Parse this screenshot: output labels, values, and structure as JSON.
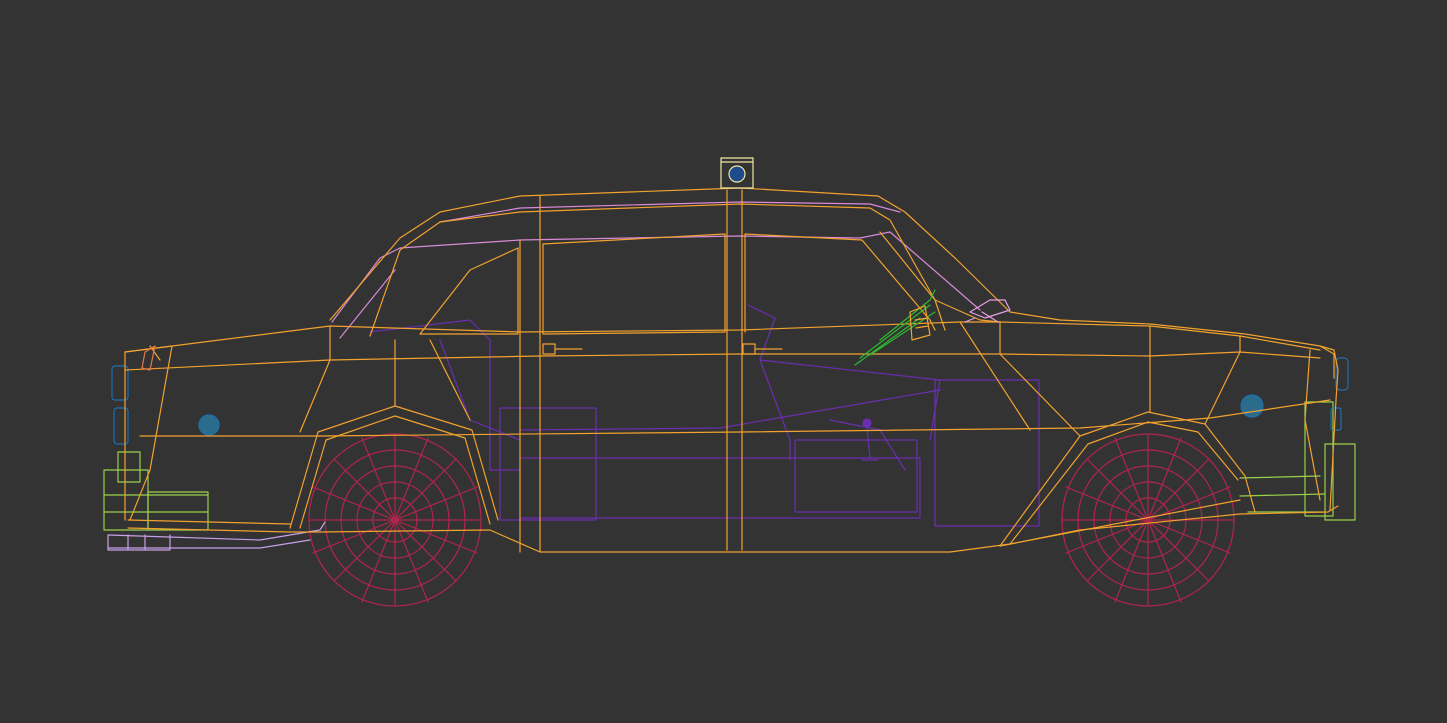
{
  "viewport": {
    "label": "",
    "background": "#333333"
  },
  "colors": {
    "body": "#f2a22e",
    "roof_trim": "#d98ad8",
    "interior": "#6a2fb0",
    "wheels": "#b0254e",
    "bumper_green": "#9ad14a",
    "bumper_pink": "#c8a0e8",
    "lights_blue": "#1e6fb0",
    "wiper_green": "#2fb82f",
    "mirror_pink": "#e6a0e6",
    "taxi_sign": "#f0e6a0"
  },
  "icons": {
    "roof_sign": "taxi-roof-sign-icon",
    "door_handle": "door-handle-icon",
    "gear_stick": "gear-stick-icon"
  }
}
